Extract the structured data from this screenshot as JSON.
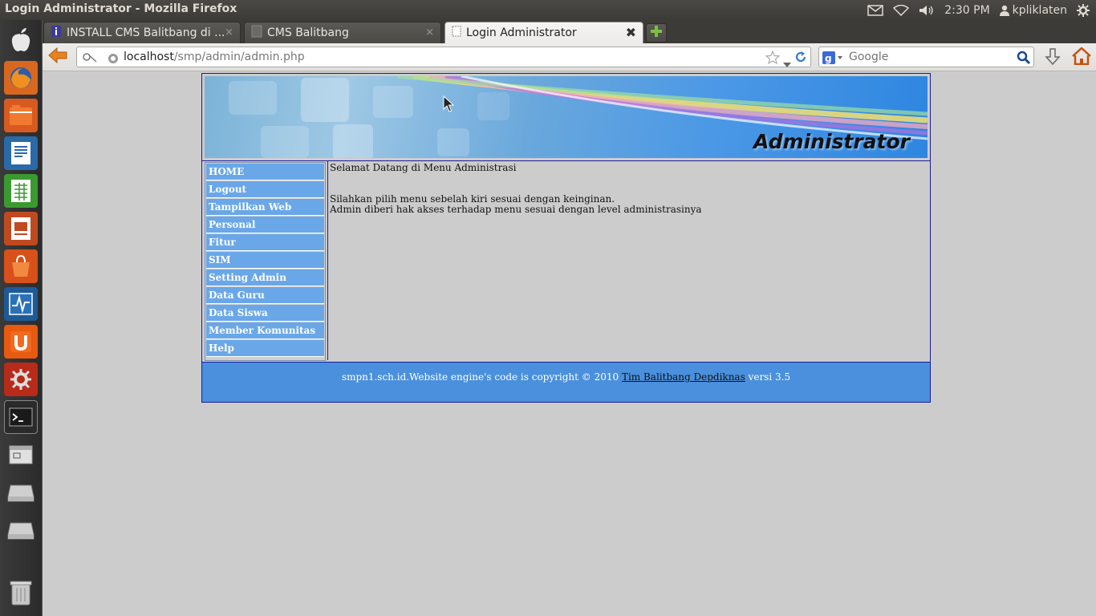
{
  "system": {
    "window_title": "Login Administrator - Mozilla Firefox",
    "clock": "2:30 PM",
    "user": "kpliklaten"
  },
  "tabs": [
    {
      "label": "INSTALL CMS Balitbang di ...",
      "close": "×"
    },
    {
      "label": "CMS Balitbang",
      "close": "×"
    },
    {
      "label": "Login Administrator",
      "close": "✖"
    }
  ],
  "navbar": {
    "url_host": "localhost",
    "url_path": "/smp/admin/admin.php",
    "search_placeholder": "Google"
  },
  "page": {
    "banner_text": "Administrator",
    "menu": [
      {
        "label": "HOME"
      },
      {
        "label": "Logout"
      },
      {
        "label": "Tampilkan Web"
      },
      {
        "label": "Personal"
      },
      {
        "label": "Fitur"
      },
      {
        "label": "SIM"
      },
      {
        "label": "Setting Admin"
      },
      {
        "label": "Data Guru"
      },
      {
        "label": "Data Siswa"
      },
      {
        "label": "Member Komunitas"
      },
      {
        "label": "Help"
      }
    ],
    "welcome": "Selamat Datang di Menu Administrasi",
    "line1": "Silahkan pilih menu sebelah kiri sesuai dengan keinginan.",
    "line2": "Admin diberi hak akses terhadap menu sesuai dengan level administrasinya",
    "footer_prefix": "smpn1.sch.id.Website engine's code is copyright © 2010 ",
    "footer_link": "Tim Balitbang Depdiknas",
    "footer_suffix": " versi 3.5"
  },
  "colors": {
    "menu_bg": "#6aa7e8",
    "footer_bg": "#4a90dc",
    "border": "#1c1c9c",
    "page_bg": "#cccccc"
  }
}
